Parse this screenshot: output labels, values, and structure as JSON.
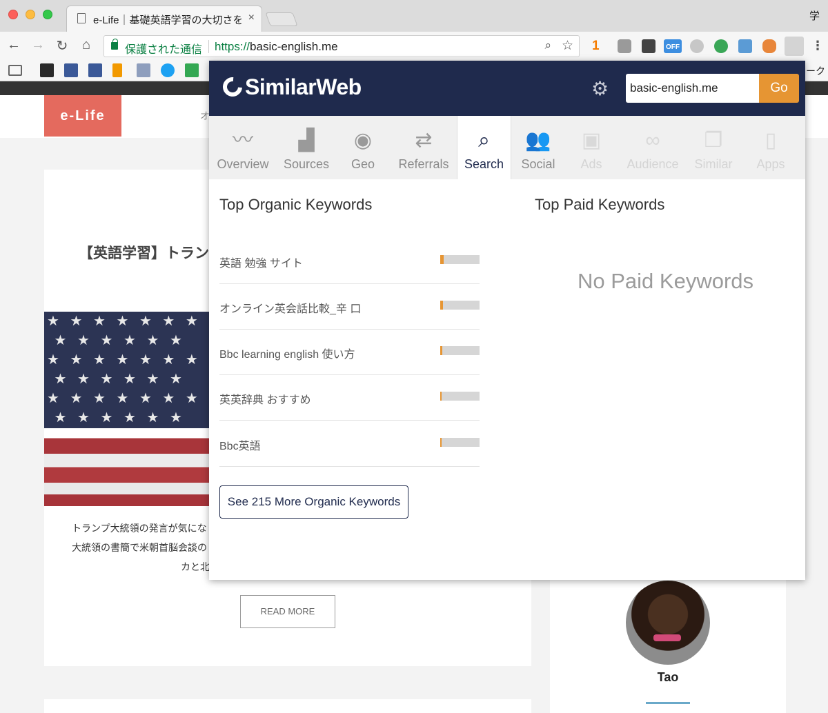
{
  "browser": {
    "tab_title": "e-Life｜基礎英語学習の大切さを伝",
    "tab_close": "×",
    "corner_char": "学",
    "secure_label": "保護された通信",
    "url_scheme": "https://",
    "url_host": "basic-english.me",
    "ext_badge": "1",
    "ext_off_label": "OFF",
    "bookmark_tail": "ーク"
  },
  "page": {
    "logo": "e-Life",
    "nav_peek": "オ",
    "post_title": "【英語学習】トランプ",
    "excerpt_lines": [
      "トランプ大統領の発言が気にな",
      "大統領の書簡で米朝首脳会談の",
      "カと北"
    ],
    "read_more": "READ MORE",
    "author": "Tao"
  },
  "popup": {
    "brand": "SimilarWeb",
    "search_value": "basic-english.me",
    "go_label": "Go",
    "tabs": [
      {
        "label": "Overview",
        "icon": "pulse-icon",
        "state": "normal"
      },
      {
        "label": "Sources",
        "icon": "bar-growth-icon",
        "state": "normal"
      },
      {
        "label": "Geo",
        "icon": "globe-icon",
        "state": "normal"
      },
      {
        "label": "Referrals",
        "icon": "arrows-icon",
        "state": "normal"
      },
      {
        "label": "Search",
        "icon": "magnifier-icon",
        "state": "active"
      },
      {
        "label": "Social",
        "icon": "people-icon",
        "state": "normal"
      },
      {
        "label": "Ads",
        "icon": "ads-icon",
        "state": "disabled"
      },
      {
        "label": "Audience",
        "icon": "binoculars-icon",
        "state": "disabled"
      },
      {
        "label": "Similar",
        "icon": "windows-icon",
        "state": "disabled"
      },
      {
        "label": "Apps",
        "icon": "phone-icon",
        "state": "disabled"
      }
    ],
    "organic_title": "Top Organic Keywords",
    "paid_title": "Top Paid Keywords",
    "organic_keywords": [
      {
        "keyword": "英語 勉強 サイト",
        "share": 0.08
      },
      {
        "keyword": "オンライン英会話比較_辛 口",
        "share": 0.07
      },
      {
        "keyword": "Bbc learning english 使い方",
        "share": 0.05
      },
      {
        "keyword": "英英辞典 おすすめ",
        "share": 0.03
      },
      {
        "keyword": "Bbc英語",
        "share": 0.03
      }
    ],
    "more_label": "See 215 More Organic Keywords",
    "no_paid": "No Paid Keywords",
    "colors": {
      "header": "#1f2a4d",
      "accent": "#e69533"
    }
  }
}
